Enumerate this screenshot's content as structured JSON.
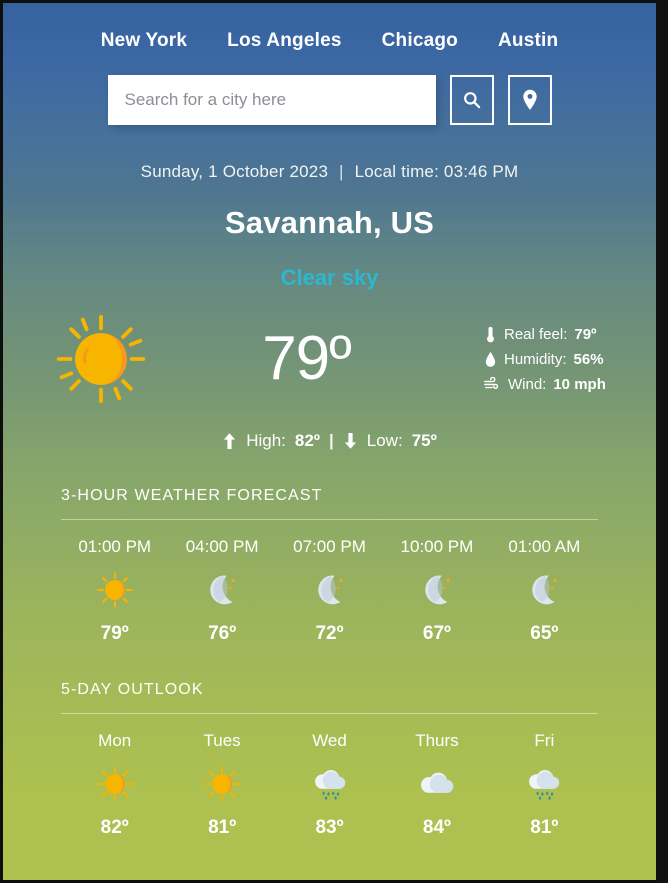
{
  "nav": {
    "items": [
      {
        "label": "New York"
      },
      {
        "label": "Los Angeles"
      },
      {
        "label": "Chicago"
      },
      {
        "label": "Austin"
      }
    ]
  },
  "search": {
    "placeholder": "Search for a city here",
    "value": "",
    "search_icon": "search-icon",
    "location_icon": "location-pin-icon"
  },
  "current": {
    "date": "Sunday, 1 October 2023",
    "separator": "|",
    "local_time": "Local time: 03:46 PM",
    "city": "Savannah, US",
    "condition": "Clear sky",
    "icon": "sun-icon",
    "temperature": "79º",
    "details": [
      {
        "icon": "thermometer-icon",
        "label": "Real feel:",
        "value": "79º"
      },
      {
        "icon": "droplet-icon",
        "label": "Humidity:",
        "value": "56%"
      },
      {
        "icon": "wind-icon",
        "label": "Wind:",
        "value": "10 mph"
      }
    ],
    "high_label": "High:",
    "high_value": "82º",
    "low_label": "Low:",
    "low_value": "75º",
    "hilo_separator": "|",
    "high_icon": "arrow-up-icon",
    "low_icon": "arrow-down-icon"
  },
  "hourly": {
    "title": "3-HOUR WEATHER FORECAST",
    "items": [
      {
        "time": "01:00 PM",
        "icon": "sun-icon",
        "temp": "79º"
      },
      {
        "time": "04:00 PM",
        "icon": "moon-stars-icon",
        "temp": "76º"
      },
      {
        "time": "07:00 PM",
        "icon": "moon-stars-icon",
        "temp": "72º"
      },
      {
        "time": "10:00 PM",
        "icon": "moon-stars-icon",
        "temp": "67º"
      },
      {
        "time": "01:00 AM",
        "icon": "moon-stars-icon",
        "temp": "65º"
      }
    ]
  },
  "daily": {
    "title": "5-DAY OUTLOOK",
    "items": [
      {
        "day": "Mon",
        "icon": "sun-icon",
        "temp": "82º"
      },
      {
        "day": "Tues",
        "icon": "sun-icon",
        "temp": "81º"
      },
      {
        "day": "Wed",
        "icon": "rain-cloud-icon",
        "temp": "83º"
      },
      {
        "day": "Thurs",
        "icon": "cloud-icon",
        "temp": "84º"
      },
      {
        "day": "Fri",
        "icon": "rain-cloud-icon",
        "temp": "81º"
      }
    ]
  },
  "colors": {
    "gradient_top": "#35639f",
    "gradient_mid": "#85a46c",
    "gradient_bottom": "#aec04f",
    "condition_text": "#2cb8ce",
    "sun": "#f7b500",
    "sun_shade": "#f59a1e",
    "moon": "#dde6ef",
    "star": "#f5a623",
    "cloud": "#dfe9f2",
    "raindrop": "#2b8fa3",
    "text": "#ffffff"
  }
}
